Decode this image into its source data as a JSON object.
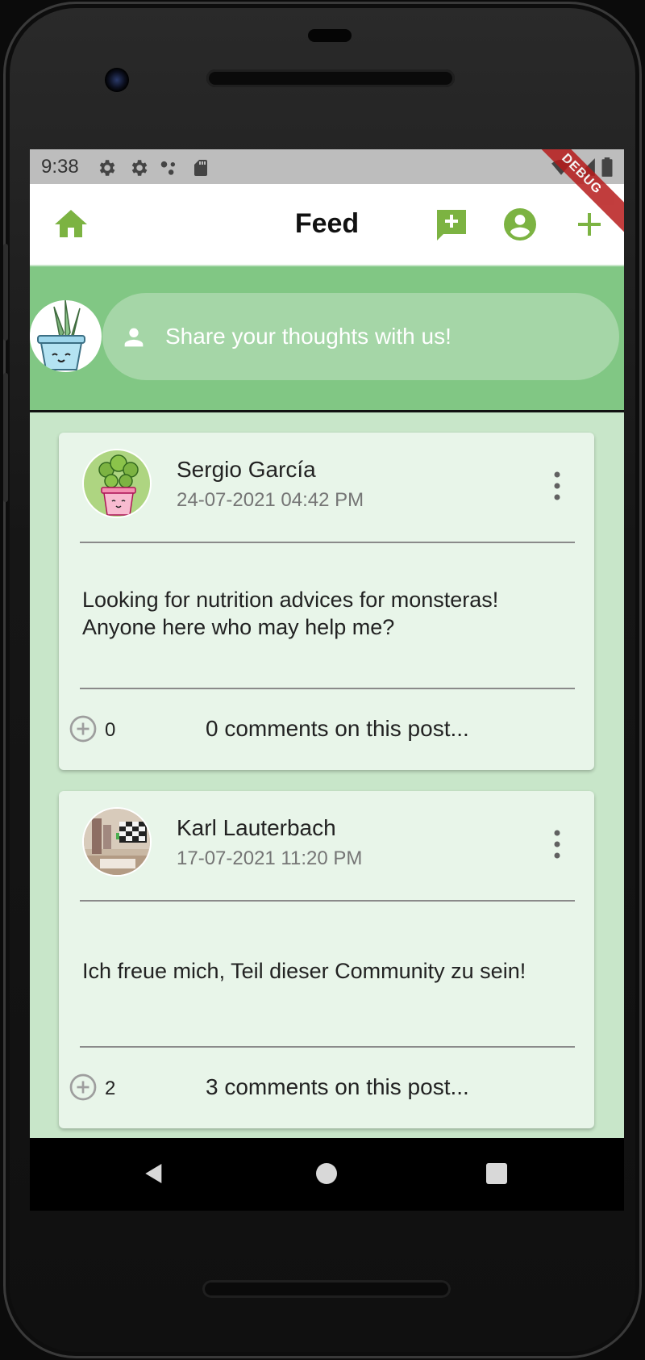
{
  "status_bar": {
    "time": "9:38",
    "icons": [
      "settings-icon",
      "settings-icon",
      "dots-icon",
      "sd-card-icon",
      "wifi-icon",
      "signal-icon",
      "battery-icon"
    ]
  },
  "debug_banner": "DEBUG",
  "app_bar": {
    "title": "Feed",
    "home_icon": "home-icon",
    "actions": [
      "add-comment-icon",
      "account-circle-icon",
      "add-icon"
    ],
    "accent_color": "#7cb342"
  },
  "composer": {
    "placeholder": "Share your thoughts with us!"
  },
  "posts": [
    {
      "author": "Sergio García",
      "date": "24-07-2021 04:42 PM",
      "body": "Looking for nutrition advices for monsteras! Anyone here who may help me?",
      "likes": "0",
      "comments": "0 comments on this post..."
    },
    {
      "author": "Karl Lauterbach",
      "date": "17-07-2021 11:20 PM",
      "body": "Ich freue mich, Teil dieser Community zu sein!",
      "likes": "2",
      "comments": "3 comments on this post..."
    }
  ],
  "colors": {
    "feed_background": "#c8e6c9",
    "composer_background": "#81c784",
    "card_background": "#e8f5e9",
    "accent": "#7cb342"
  }
}
